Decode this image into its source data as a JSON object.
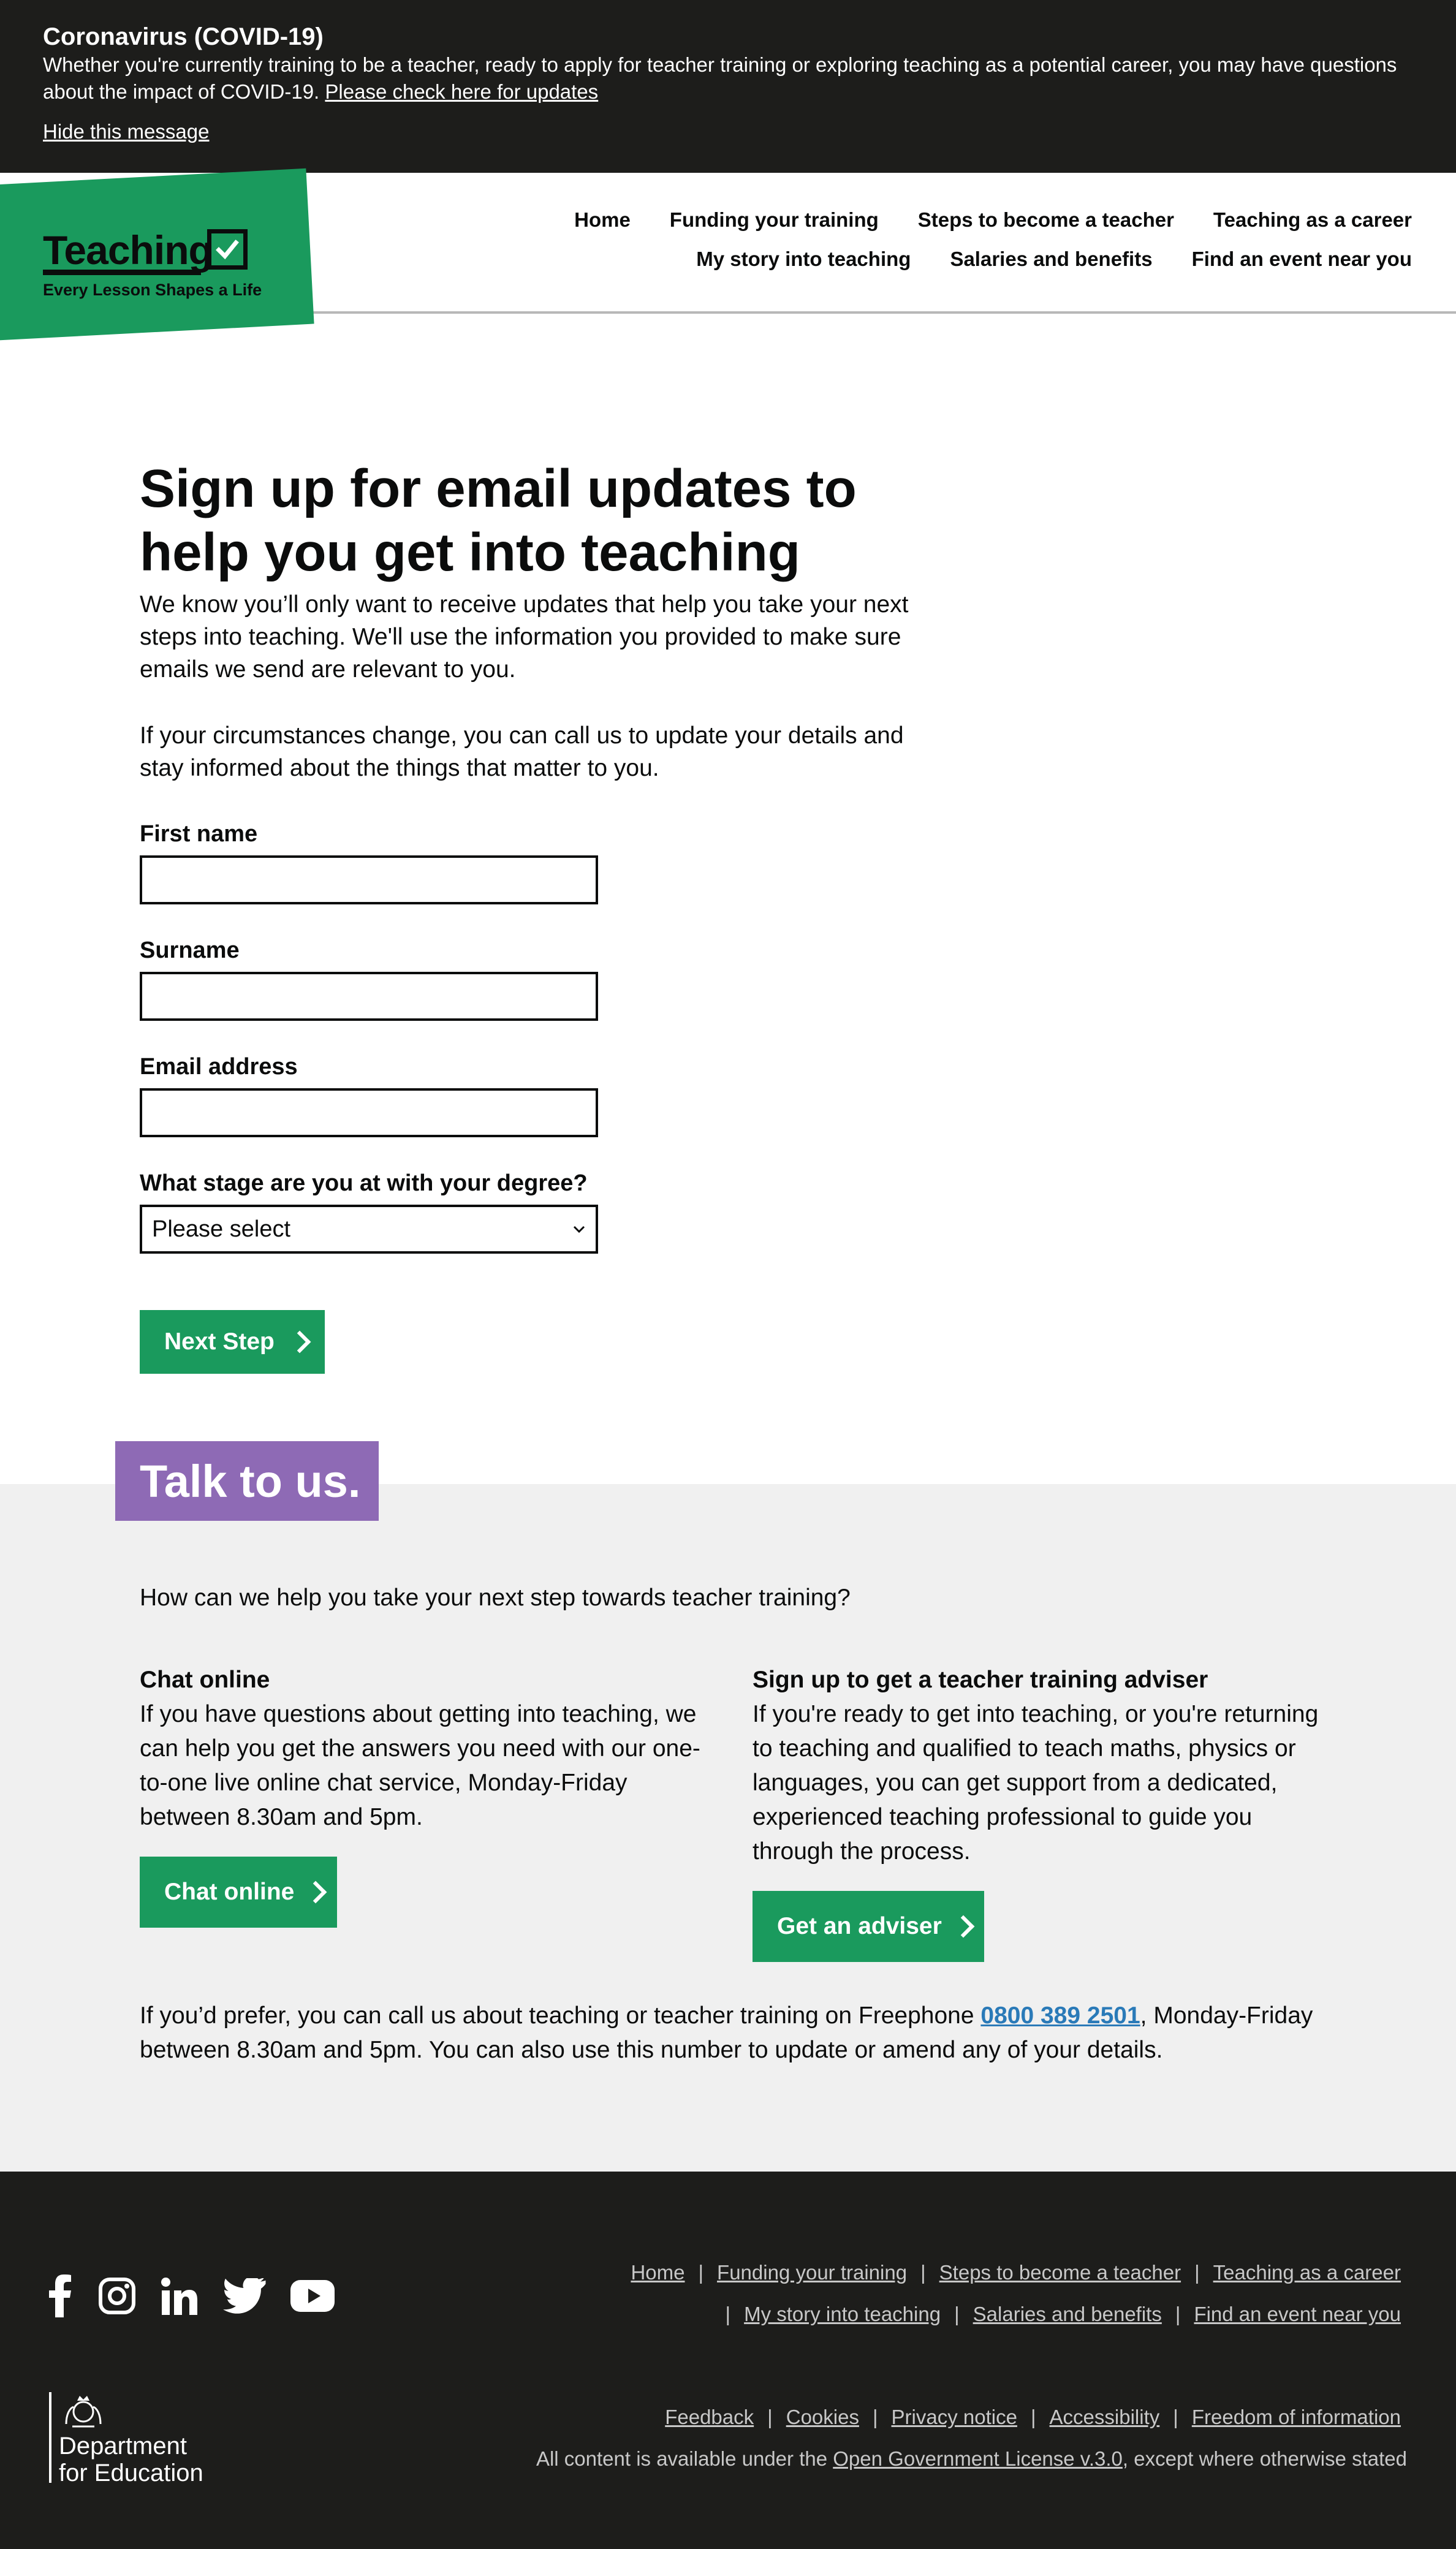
{
  "covid": {
    "title": "Coronavirus (COVID-19)",
    "text": "Whether you're currently training to be a teacher, ready to apply for teacher training or exploring teaching as a potential career, you may have questions about the impact of COVID-19.",
    "link": "Please check here for updates",
    "hide": "Hide this message"
  },
  "logo": {
    "word": "Teaching",
    "tagline": "Every Lesson Shapes a Life"
  },
  "nav": {
    "row1": [
      "Home",
      "Funding your training",
      "Steps to become a teacher",
      "Teaching as a career"
    ],
    "row2": [
      "My story into teaching",
      "Salaries and benefits",
      "Find an event near you"
    ]
  },
  "main": {
    "title": "Sign up for email updates to help you get into teaching",
    "intro1": "We know you’ll only want to receive updates that help you take your next steps into teaching. We'll use the information you provided to make sure emails we send are relevant to you.",
    "intro2": "If your circumstances change, you can call us to update your details and stay informed about the things that matter to you.",
    "fields": {
      "first_name": "First name",
      "surname": "Surname",
      "email": "Email address",
      "degree": "What stage are you at with your degree?",
      "degree_value": "Please select"
    },
    "next": "Next Step"
  },
  "talk": {
    "tag": "Talk to us.",
    "question": "How can we help you take your next step towards teacher training?",
    "chat_title": "Chat online",
    "chat_text": "If you have questions about getting into teaching, we can help you get the answers you need with our one-to-one live online chat service, Monday-Friday between 8.30am and 5pm.",
    "chat_button": "Chat online",
    "adviser_title": "Sign up to get a teacher training adviser",
    "adviser_text": "If you're ready to get into teaching, or you're returning to teaching and qualified to teach maths, physics or languages, you can get support from a dedicated, experienced teaching professional to guide you through the process.",
    "adviser_button": "Get an adviser",
    "phone_pre": "If you’d prefer, you can call us about teaching or teacher training on Freephone",
    "phone": "0800 389 2501",
    "phone_post": ", Monday-Friday between 8.30am and 5pm. You can also use this number to update or amend any of your details."
  },
  "footer": {
    "nav1": [
      "Home",
      "Funding your training",
      "Steps to become a teacher",
      "Teaching as a career"
    ],
    "nav2": [
      "My story into teaching",
      "Salaries and benefits",
      "Find an event near you"
    ],
    "nav3": [
      "Feedback",
      "Cookies",
      "Privacy notice",
      "Accessibility",
      "Freedom of information"
    ],
    "dfe_line1": "Department",
    "dfe_line2": "for Education",
    "license_pre": "All content is available under the",
    "license_link": "Open Government License v.3.0",
    "license_post": ", except where otherwise stated",
    "social": [
      "facebook-icon",
      "instagram-icon",
      "linkedin-icon",
      "twitter-icon",
      "youtube-icon"
    ]
  },
  "colors": {
    "brand_green": "#1a9a5d",
    "talk_purple": "#8e6ab5",
    "dark": "#1d1d1b",
    "phone_blue": "#2a7ab8"
  }
}
